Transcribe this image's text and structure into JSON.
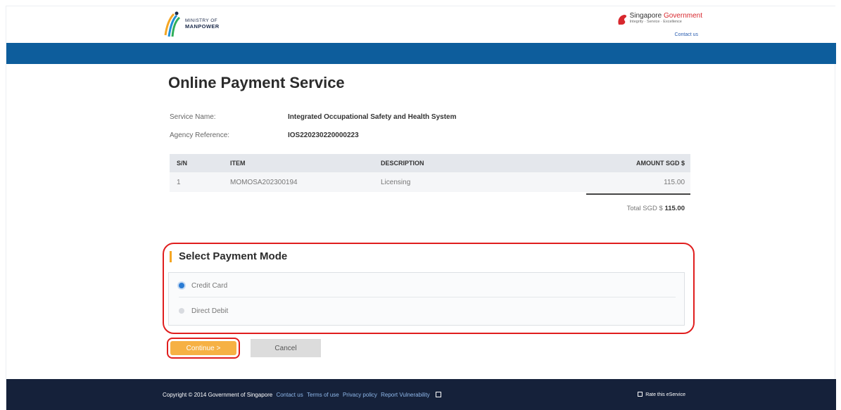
{
  "header": {
    "ministry_line1": "MINISTRY OF",
    "ministry_line2": "MANPOWER",
    "sg_gov_prefix": "Singapore ",
    "sg_gov_suffix": "Government",
    "sg_tagline": "Integrity · Service · Excellence",
    "contact_us": "Contact us"
  },
  "page": {
    "title": "Online Payment Service",
    "service_name_label": "Service Name:",
    "service_name_value": "Integrated Occupational Safety and Health System",
    "agency_ref_label": "Agency Reference:",
    "agency_ref_value": "IOS220230220000223"
  },
  "table": {
    "headers": {
      "sn": "S/N",
      "item": "ITEM",
      "description": "DESCRIPTION",
      "amount": "AMOUNT SGD $"
    },
    "rows": [
      {
        "sn": "1",
        "item": "MOMOSA202300194",
        "description": "Licensing",
        "amount": "115.00"
      }
    ],
    "total_label": "Total SGD $ ",
    "total_value": "115.00"
  },
  "payment": {
    "title": "Select Payment Mode",
    "options": [
      {
        "label": "Credit Card",
        "selected": true
      },
      {
        "label": "Direct Debit",
        "selected": false
      }
    ]
  },
  "buttons": {
    "continue": "Continue >",
    "cancel": "Cancel"
  },
  "footer": {
    "copyright": "Copyright © 2014 Government of Singapore",
    "contact_us": "Contact us",
    "terms": "Terms of use",
    "privacy": "Privacy policy",
    "report": "Report Vulnerability",
    "rate": "Rate this eService"
  },
  "colors": {
    "blue_band": "#0d5d9c",
    "footer_bg": "#15213a",
    "continue_bg": "#f6b144",
    "highlight_red": "#e01e1e"
  }
}
